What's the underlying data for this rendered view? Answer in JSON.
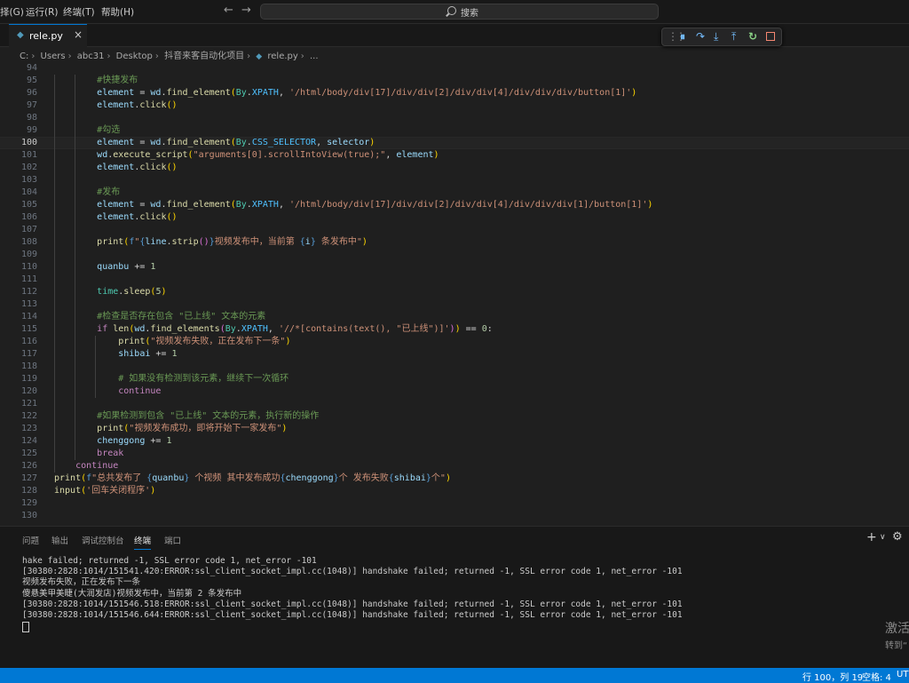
{
  "titlebar": {
    "menus": [
      "择(G)",
      "运行(R)",
      "终端(T)",
      "帮助(H)"
    ],
    "search_label": "搜索"
  },
  "tab": {
    "filename": "rele.py",
    "close_glyph": "×"
  },
  "breadcrumb": [
    "C:",
    "Users",
    "abc31",
    "Desktop",
    "抖音来客自动化项目",
    "rele.py",
    "..."
  ],
  "editor": {
    "current_line": 100,
    "line_numbers": [
      94,
      95,
      96,
      97,
      98,
      99,
      100,
      101,
      102,
      103,
      104,
      105,
      106,
      107,
      108,
      109,
      110,
      111,
      112,
      113,
      114,
      115,
      116,
      117,
      118,
      119,
      120,
      121,
      122,
      123,
      124,
      125,
      126,
      127,
      128,
      129,
      130
    ]
  },
  "panel": {
    "tabs": [
      "问题",
      "输出",
      "调试控制台",
      "终端",
      "端口"
    ],
    "active_tab": "终端",
    "terminal_lines": [
      "hake failed; returned -1, SSL error code 1, net_error -101",
      "[30380:2828:1014/151541.420:ERROR:ssl_client_socket_impl.cc(1048)] handshake failed; returned -1, SSL error code 1, net_error -101",
      "视频发布失败，正在发布下一条",
      "傻悬美甲美睫(大润发店)视频发布中，当前第 2 条发布中",
      "[30380:2828:1014/151546.518:ERROR:ssl_client_socket_impl.cc(1048)] handshake failed; returned -1, SSL error code 1, net_error -101",
      "[30380:2828:1014/151546.644:ERROR:ssl_client_socket_impl.cc(1048)] handshake failed; returned -1, SSL error code 1, net_error -101"
    ],
    "watermark_line1": "激活",
    "watermark_line2": "转到“"
  },
  "statusbar": {
    "position": "行 100，列 19",
    "spaces": "空格: 4",
    "encoding": "UTF"
  },
  "colors": {
    "accent": "#0078d4",
    "status_bg": "#0078d4"
  }
}
